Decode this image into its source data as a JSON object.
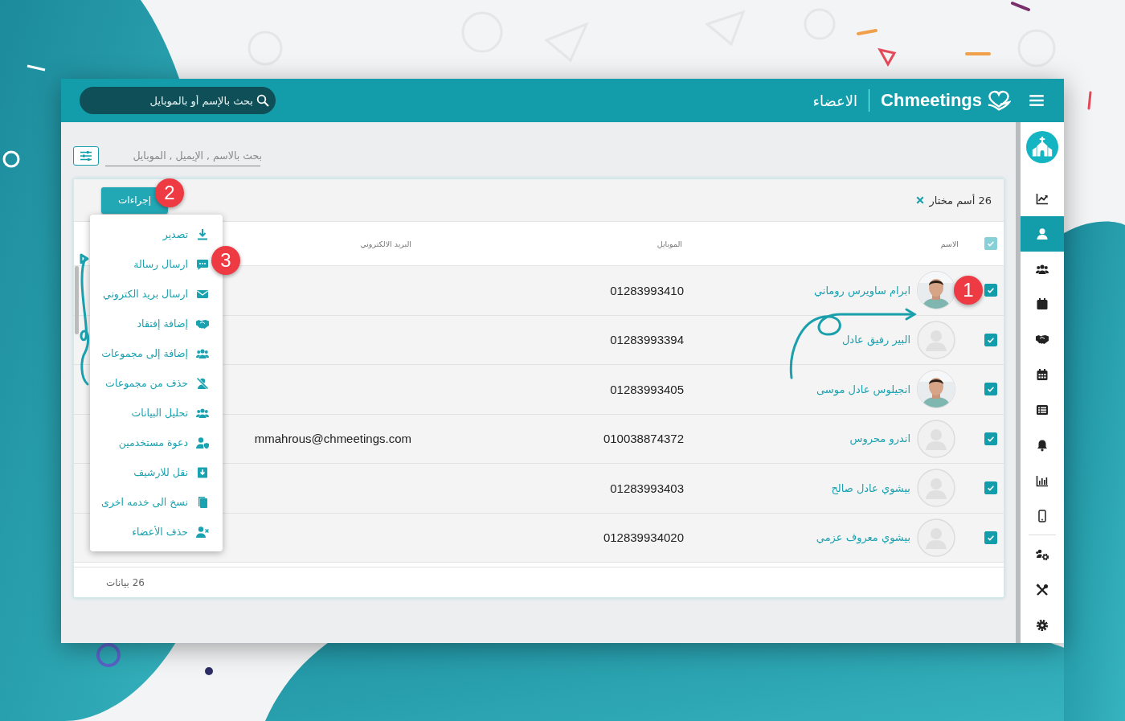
{
  "header": {
    "brand": "Chmeetings",
    "title": "الاعضاء",
    "search": {
      "placeholder": "بحث بالإسم أو بالموبايل"
    }
  },
  "sidebar": {
    "items": [
      {
        "selected": false
      },
      {
        "selected": true
      },
      {
        "selected": false
      },
      {
        "selected": false
      },
      {
        "selected": false
      },
      {
        "selected": false
      },
      {
        "selected": false
      },
      {
        "selected": false
      },
      {
        "selected": false
      },
      {
        "selected": false
      },
      {
        "selected": false
      },
      {
        "selected": false
      },
      {
        "selected": false
      }
    ]
  },
  "filter": {
    "search": {
      "placeholder": "بحث بالاسم , الإيميل , الموبايل"
    }
  },
  "table": {
    "selection": "26 أسم مختار",
    "actions_button": "إجراءات",
    "actions_menu": [
      "تصدير",
      "ارسال رسالة",
      "ارسال بريد الكتروني",
      "إضافة إفتقاد",
      "إضافة إلى مجموعات",
      "حذف من مجموعات",
      "تحليل البيانات",
      "دعوة مستخدمين",
      "نقل للارشيف",
      "نسخ الى خدمه اخرى",
      "حذف الأعضاء"
    ],
    "select_all": true,
    "columns": [
      "الاسم",
      "الموبايل",
      "البريد الالكتروني"
    ],
    "rows": [
      {
        "checked": true,
        "name": "ابرام ساويرس روماني",
        "mobile": "01283993410"
      },
      {
        "checked": true,
        "avatar": {
          "kind": "placeholder"
        },
        "name": "البير رفيق عادل",
        "mobile": "01283993394"
      },
      {
        "checked": true,
        "name": "انجيلوس عادل موسى",
        "mobile": "01283993405"
      },
      {
        "checked": true,
        "avatar": {
          "kind": "placeholder"
        },
        "name": "اندرو محروس",
        "mobile": "010038874372",
        "email": "mmahrous@chmeetings.com"
      },
      {
        "checked": true,
        "avatar": {
          "kind": "placeholder"
        },
        "name": "بيشوي عادل صالح",
        "mobile": "01283993403"
      },
      {
        "checked": true,
        "avatar": {
          "kind": "placeholder"
        },
        "name": "بيشوي معروف عزمي",
        "mobile": "012839934020"
      }
    ],
    "footer": "26 بيانات"
  },
  "callouts": [
    {
      "label": "1"
    },
    {
      "label": "2"
    },
    {
      "label": "3"
    }
  ]
}
